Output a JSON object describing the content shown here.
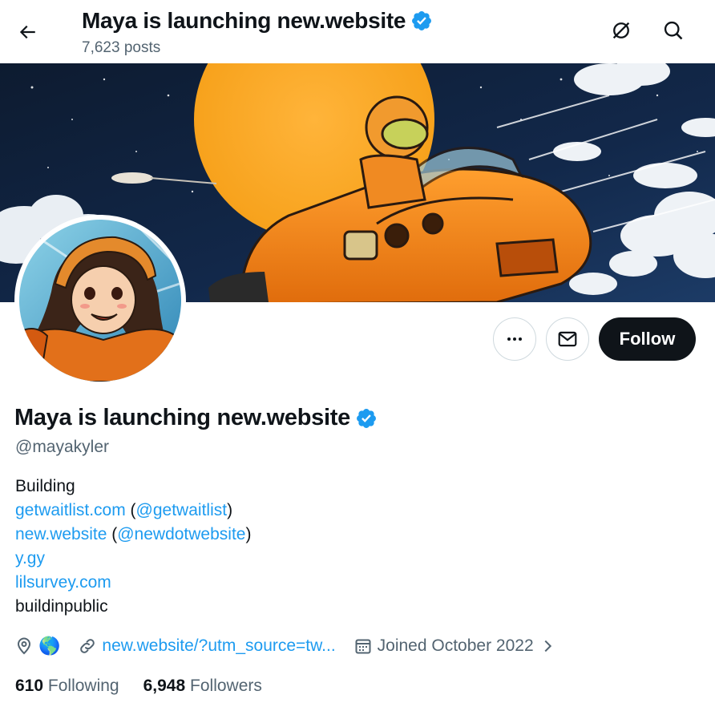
{
  "header": {
    "title": "Maya is launching new.website",
    "post_count": "7,623 posts"
  },
  "profile": {
    "display_name": "Maya is launching new.website",
    "handle": "@mayakyler",
    "follow_label": "Follow"
  },
  "bio": {
    "line1": "Building",
    "line2_link": "getwaitlist.com",
    "line2_open": " (",
    "line2_mention": "@getwaitlist",
    "line2_close": ")",
    "line3_link": "new.website",
    "line3_open": " (",
    "line3_mention": "@newdotwebsite",
    "line3_close": ")",
    "line4_link": "y.gy",
    "line5_link": "lilsurvey.com",
    "line6": "buildinpublic"
  },
  "meta": {
    "location": "🌎",
    "website": "new.website/?utm_source=tw...",
    "joined": "Joined October 2022"
  },
  "stats": {
    "following_count": "610",
    "following_label": "Following",
    "followers_count": "6,948",
    "followers_label": "Followers"
  },
  "colors": {
    "accent": "#1d9bf0",
    "text": "#0f1419",
    "muted": "#536471",
    "follow_bg": "#0f1419"
  },
  "icons": [
    "back-arrow-icon",
    "grok-icon",
    "search-icon",
    "more-icon",
    "mail-icon",
    "verified-badge-icon",
    "location-icon",
    "link-icon",
    "calendar-icon",
    "chevron-right-icon"
  ]
}
